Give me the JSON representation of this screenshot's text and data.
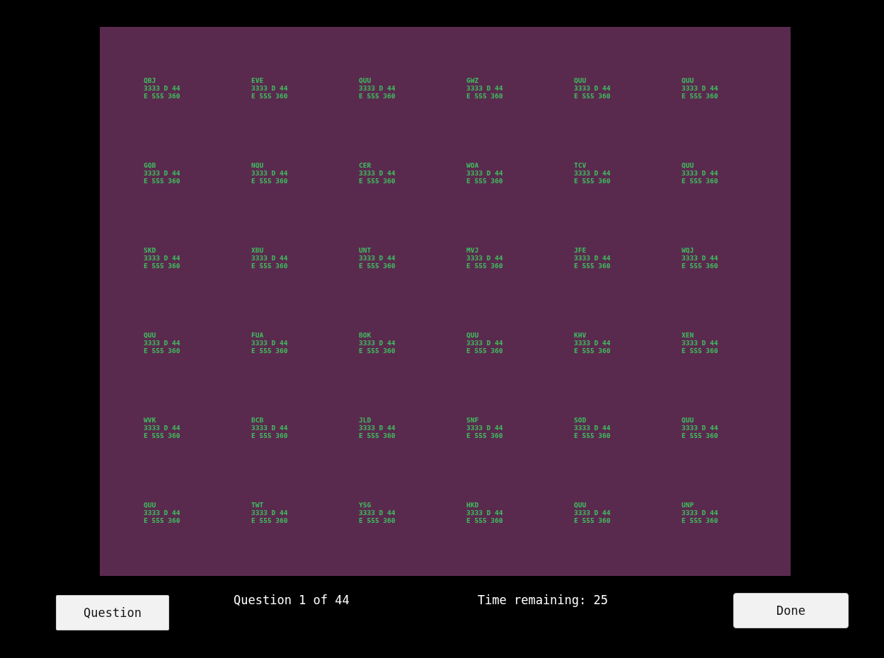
{
  "targets": [
    {
      "callsign": "QBJ",
      "line_2": "3333 D 44",
      "line_3": "E 555 360"
    },
    {
      "callsign": "EVE",
      "line_2": "3333 D 44",
      "line_3": "E 555 360"
    },
    {
      "callsign": "QUU",
      "line_2": "3333 D 44",
      "line_3": "E 555 360"
    },
    {
      "callsign": "GWZ",
      "line_2": "3333 D 44",
      "line_3": "E 555 360"
    },
    {
      "callsign": "QUU",
      "line_2": "3333 D 44",
      "line_3": "E 555 360"
    },
    {
      "callsign": "QUU",
      "line_2": "3333 D 44",
      "line_3": "E 555 360"
    },
    {
      "callsign": "GQB",
      "line_2": "3333 D 44",
      "line_3": "E 555 360"
    },
    {
      "callsign": "NQU",
      "line_2": "3333 D 44",
      "line_3": "E 555 360"
    },
    {
      "callsign": "CER",
      "line_2": "3333 D 44",
      "line_3": "E 555 360"
    },
    {
      "callsign": "WOA",
      "line_2": "3333 D 44",
      "line_3": "E 555 360"
    },
    {
      "callsign": "TCV",
      "line_2": "3333 D 44",
      "line_3": "E 555 360"
    },
    {
      "callsign": "QUU",
      "line_2": "3333 D 44",
      "line_3": "E 555 360"
    },
    {
      "callsign": "SKD",
      "line_2": "3333 D 44",
      "line_3": "E 555 360"
    },
    {
      "callsign": "XBU",
      "line_2": "3333 D 44",
      "line_3": "E 555 360"
    },
    {
      "callsign": "UNT",
      "line_2": "3333 D 44",
      "line_3": "E 555 360"
    },
    {
      "callsign": "MVJ",
      "line_2": "3333 D 44",
      "line_3": "E 555 360"
    },
    {
      "callsign": "JFE",
      "line_2": "3333 D 44",
      "line_3": "E 555 360"
    },
    {
      "callsign": "WQJ",
      "line_2": "3333 D 44",
      "line_3": "E 555 360"
    },
    {
      "callsign": "QUU",
      "line_2": "3333 D 44",
      "line_3": "E 555 360"
    },
    {
      "callsign": "FUA",
      "line_2": "3333 D 44",
      "line_3": "E 555 360"
    },
    {
      "callsign": "BOK",
      "line_2": "3333 D 44",
      "line_3": "E 555 360"
    },
    {
      "callsign": "QUU",
      "line_2": "3333 D 44",
      "line_3": "E 555 360"
    },
    {
      "callsign": "KHV",
      "line_2": "3333 D 44",
      "line_3": "E 555 360"
    },
    {
      "callsign": "XEN",
      "line_2": "3333 D 44",
      "line_3": "E 555 360"
    },
    {
      "callsign": "WVK",
      "line_2": "3333 D 44",
      "line_3": "E 555 360"
    },
    {
      "callsign": "BCB",
      "line_2": "3333 D 44",
      "line_3": "E 555 360"
    },
    {
      "callsign": "JLD",
      "line_2": "3333 D 44",
      "line_3": "E 555 360"
    },
    {
      "callsign": "SNF",
      "line_2": "3333 D 44",
      "line_3": "E 555 360"
    },
    {
      "callsign": "SOD",
      "line_2": "3333 D 44",
      "line_3": "E 555 360"
    },
    {
      "callsign": "QUU",
      "line_2": "3333 D 44",
      "line_3": "E 555 360"
    },
    {
      "callsign": "QUU",
      "line_2": "3333 D 44",
      "line_3": "E 555 360"
    },
    {
      "callsign": "TWT",
      "line_2": "3333 D 44",
      "line_3": "E 555 360"
    },
    {
      "callsign": "YSG",
      "line_2": "3333 D 44",
      "line_3": "E 555 360"
    },
    {
      "callsign": "HKD",
      "line_2": "3333 D 44",
      "line_3": "E 555 360"
    },
    {
      "callsign": "QUU",
      "line_2": "3333 D 44",
      "line_3": "E 555 360"
    },
    {
      "callsign": "UNP",
      "line_2": "3333 D 44",
      "line_3": "E 555 360"
    }
  ],
  "question_button": "Question",
  "question_counter": "Question 1 of 44",
  "time_remaining": "Time remaining: 25",
  "done_button": "Done"
}
